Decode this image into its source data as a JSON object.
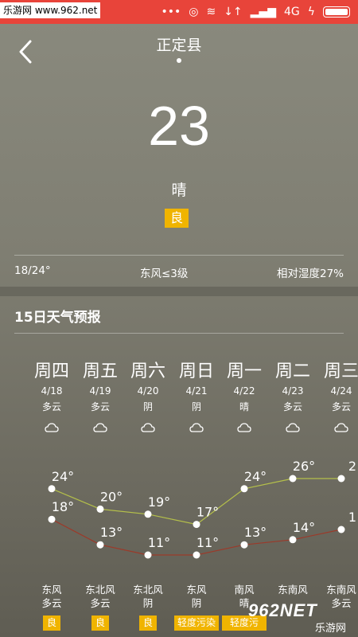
{
  "watermark": "乐游网 www.962.net",
  "statusbar": {
    "network": "4G"
  },
  "header": {
    "city": "正定县"
  },
  "current": {
    "temperature": "23",
    "condition": "晴",
    "aqi": "良"
  },
  "info": {
    "range": "18/24°",
    "wind": "东风≤3级",
    "humidity": "相对湿度27%"
  },
  "forecast": {
    "title": "15日天气预报",
    "days": [
      {
        "name": "周四",
        "date": "4/18",
        "cond": "多云",
        "high": "24°",
        "low": "18°",
        "wind": "东风",
        "wind2": "多云",
        "aqi": "良"
      },
      {
        "name": "周五",
        "date": "4/19",
        "cond": "多云",
        "high": "20°",
        "low": "13°",
        "wind": "东北风",
        "wind2": "多云",
        "aqi": "良"
      },
      {
        "name": "周六",
        "date": "4/20",
        "cond": "阴",
        "high": "19°",
        "low": "11°",
        "wind": "东北风",
        "wind2": "阴",
        "aqi": "良"
      },
      {
        "name": "周日",
        "date": "4/21",
        "cond": "阴",
        "high": "17°",
        "low": "11°",
        "wind": "东风",
        "wind2": "阴",
        "aqi": "轻度污染"
      },
      {
        "name": "周一",
        "date": "4/22",
        "cond": "晴",
        "high": "24°",
        "low": "13°",
        "wind": "南风",
        "wind2": "晴",
        "aqi": "轻度污"
      },
      {
        "name": "周二",
        "date": "4/23",
        "cond": "多云",
        "high": "26°",
        "low": "14°",
        "wind": "东南风",
        "wind2": "",
        "aqi": ""
      },
      {
        "name": "周三",
        "date": "4/24",
        "cond": "多云",
        "high": "2",
        "low": "1",
        "wind": "东南风",
        "wind2": "多云",
        "aqi": ""
      }
    ]
  },
  "logo": {
    "text": "乐游网",
    "number": "962NET"
  },
  "colors": {
    "high_line": "#b5c04a",
    "low_line": "#9b3a2a",
    "aqi_badge": "#f0b400",
    "statusbar": "#e8443a"
  }
}
